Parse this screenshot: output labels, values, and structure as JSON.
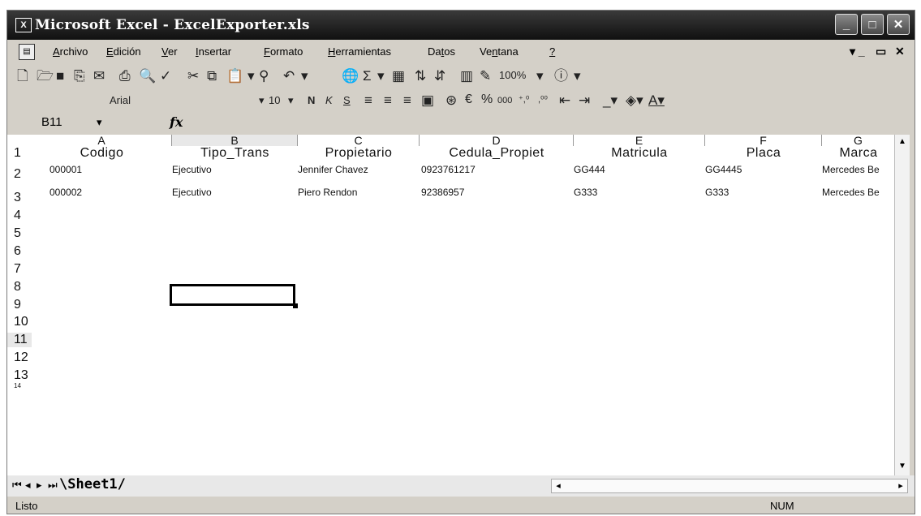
{
  "window": {
    "title": "Microsoft Excel - ExcelExporter.xls",
    "app_icon": "excel-icon"
  },
  "menu": {
    "items": [
      {
        "label": "Archivo",
        "underline": "A",
        "rest": "rchivo"
      },
      {
        "label": "Edición",
        "underline": "E",
        "rest": "dición"
      },
      {
        "label": "Ver",
        "underline": "V",
        "rest": "er"
      },
      {
        "label": "Insertar",
        "underline": "I",
        "rest": "nsertar"
      },
      {
        "label": "Formato",
        "underline": "F",
        "rest": "ormato"
      },
      {
        "label": "Herramientas",
        "underline": "H",
        "rest": "erramientas"
      },
      {
        "label": "Datos",
        "pre": "Da",
        "underline": "t",
        "rest": "os"
      },
      {
        "label": "Ventana",
        "pre": "Ve",
        "underline": "n",
        "rest": "tana"
      },
      {
        "label": "?",
        "underline": "?",
        "rest": ""
      }
    ]
  },
  "standard_toolbar": {
    "zoom": "100%",
    "icons": [
      "new-icon",
      "open-icon",
      "save-icon",
      "permission-icon",
      "email-icon",
      "print-icon",
      "print-preview-icon",
      "spelling-icon",
      "cut-icon",
      "copy-icon",
      "paste-icon",
      "format-painter-icon",
      "undo-icon",
      "hyperlink-icon",
      "autosum-icon",
      "insert-function-icon",
      "sort-ascending-icon",
      "sort-descending-icon",
      "chart-wizard-icon",
      "drawing-icon",
      "help-icon"
    ]
  },
  "formatting_toolbar": {
    "font": "Arial",
    "size": "10",
    "bold": "N",
    "italic": "K",
    "underline": "S",
    "euro": "€",
    "percent": "%",
    "thousands": "000"
  },
  "formula_bar": {
    "name_box": "B11",
    "fx": "fx",
    "value": ""
  },
  "grid": {
    "columns": [
      "A",
      "B",
      "C",
      "D",
      "E",
      "F",
      "G"
    ],
    "rows": [
      "1",
      "2",
      "3",
      "4",
      "5",
      "6",
      "7",
      "8",
      "9",
      "10",
      "11",
      "12",
      "13",
      "14"
    ],
    "header_row": [
      "Codigo",
      "Tipo_Trans",
      "Propietario",
      "Cedula_Propiet",
      "Matricula",
      "Placa",
      "Marca"
    ],
    "data": [
      [
        "000001",
        "Ejecutivo",
        "Jennifer Chavez",
        "0923761217",
        "GG444",
        "GG4445",
        "Mercedes Be"
      ],
      [
        "000002",
        "Ejecutivo",
        "Piero Rendon",
        "92386957",
        "G333",
        "G333",
        "Mercedes Be"
      ]
    ],
    "active_cell": "B11"
  },
  "sheet_tabs": {
    "tabs": [
      "Sheet1"
    ],
    "active": "Sheet1"
  },
  "status": {
    "left": "Listo",
    "num": "NUM"
  }
}
